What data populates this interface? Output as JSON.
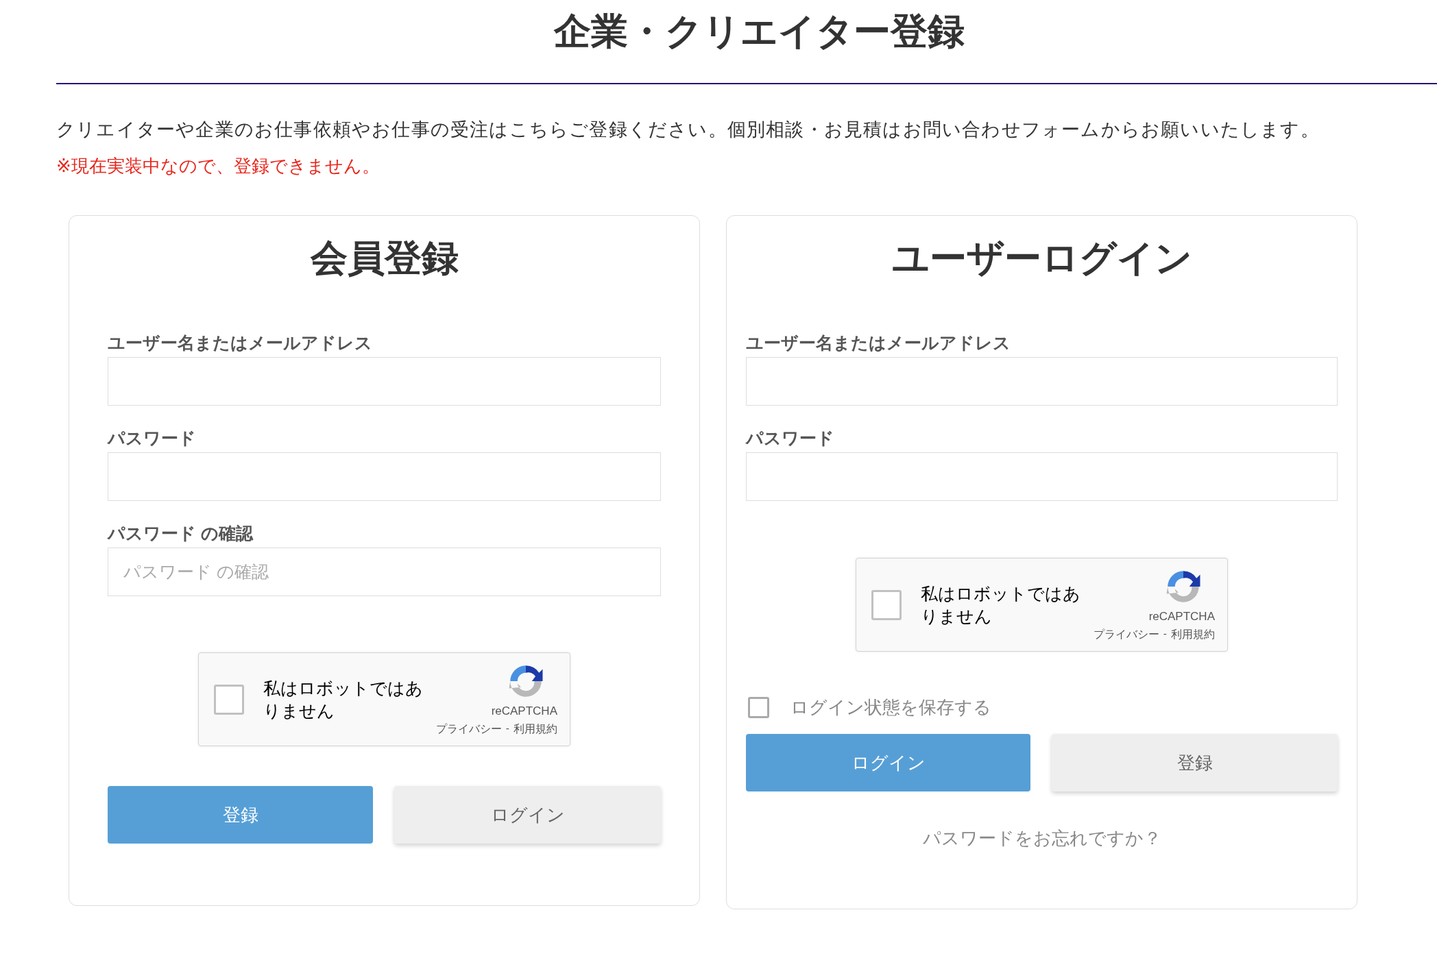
{
  "title": "企業・クリエイター登録",
  "intro": "クリエイターや企業のお仕事依頼やお仕事の受注はこちらご登録ください。個別相談・お見積はお問い合わせフォームからお願いいたします。",
  "notice": "※現在実装中なので、登録できません。",
  "cards": [
    {
      "kind": "register",
      "heading": "会員登録",
      "fields": [
        {
          "label": "ユーザー名またはメールアドレス"
        },
        {
          "label": "パスワード"
        },
        {
          "label": "パスワード の確認",
          "placeholder": "パスワード の確認"
        }
      ],
      "captcha": {
        "label": "私はロボットではありません",
        "checked": false,
        "brand": "reCAPTCHA",
        "privacy": "プライバシー",
        "separator": "-",
        "terms": "利用規約"
      },
      "buttons": [
        {
          "label": "登録",
          "kind": "primary"
        },
        {
          "label": "ログイン",
          "kind": "secondary"
        }
      ]
    },
    {
      "kind": "login",
      "heading": "ユーザーログイン",
      "fields": [
        {
          "label": "ユーザー名またはメールアドレス"
        },
        {
          "label": "パスワード"
        }
      ],
      "captcha": {
        "label": "私はロボットではありません",
        "checked": false,
        "brand": "reCAPTCHA",
        "privacy": "プライバシー",
        "separator": "-",
        "terms": "利用規約"
      },
      "remember": {
        "label": "ログイン状態を保存する",
        "checked": false
      },
      "buttons": [
        {
          "label": "ログイン",
          "kind": "primary"
        },
        {
          "label": "登録",
          "kind": "secondary"
        }
      ],
      "forgot_link": "パスワードをお忘れですか？"
    }
  ]
}
